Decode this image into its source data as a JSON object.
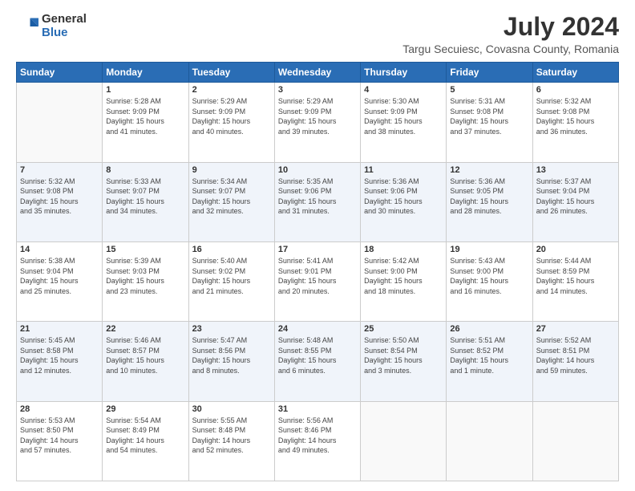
{
  "header": {
    "logo_general": "General",
    "logo_blue": "Blue",
    "title": "July 2024",
    "subtitle": "Targu Secuiesc, Covasna County, Romania"
  },
  "weekdays": [
    "Sunday",
    "Monday",
    "Tuesday",
    "Wednesday",
    "Thursday",
    "Friday",
    "Saturday"
  ],
  "weeks": [
    [
      {
        "day": "",
        "info": ""
      },
      {
        "day": "1",
        "info": "Sunrise: 5:28 AM\nSunset: 9:09 PM\nDaylight: 15 hours\nand 41 minutes."
      },
      {
        "day": "2",
        "info": "Sunrise: 5:29 AM\nSunset: 9:09 PM\nDaylight: 15 hours\nand 40 minutes."
      },
      {
        "day": "3",
        "info": "Sunrise: 5:29 AM\nSunset: 9:09 PM\nDaylight: 15 hours\nand 39 minutes."
      },
      {
        "day": "4",
        "info": "Sunrise: 5:30 AM\nSunset: 9:09 PM\nDaylight: 15 hours\nand 38 minutes."
      },
      {
        "day": "5",
        "info": "Sunrise: 5:31 AM\nSunset: 9:08 PM\nDaylight: 15 hours\nand 37 minutes."
      },
      {
        "day": "6",
        "info": "Sunrise: 5:32 AM\nSunset: 9:08 PM\nDaylight: 15 hours\nand 36 minutes."
      }
    ],
    [
      {
        "day": "7",
        "info": "Sunrise: 5:32 AM\nSunset: 9:08 PM\nDaylight: 15 hours\nand 35 minutes."
      },
      {
        "day": "8",
        "info": "Sunrise: 5:33 AM\nSunset: 9:07 PM\nDaylight: 15 hours\nand 34 minutes."
      },
      {
        "day": "9",
        "info": "Sunrise: 5:34 AM\nSunset: 9:07 PM\nDaylight: 15 hours\nand 32 minutes."
      },
      {
        "day": "10",
        "info": "Sunrise: 5:35 AM\nSunset: 9:06 PM\nDaylight: 15 hours\nand 31 minutes."
      },
      {
        "day": "11",
        "info": "Sunrise: 5:36 AM\nSunset: 9:06 PM\nDaylight: 15 hours\nand 30 minutes."
      },
      {
        "day": "12",
        "info": "Sunrise: 5:36 AM\nSunset: 9:05 PM\nDaylight: 15 hours\nand 28 minutes."
      },
      {
        "day": "13",
        "info": "Sunrise: 5:37 AM\nSunset: 9:04 PM\nDaylight: 15 hours\nand 26 minutes."
      }
    ],
    [
      {
        "day": "14",
        "info": "Sunrise: 5:38 AM\nSunset: 9:04 PM\nDaylight: 15 hours\nand 25 minutes."
      },
      {
        "day": "15",
        "info": "Sunrise: 5:39 AM\nSunset: 9:03 PM\nDaylight: 15 hours\nand 23 minutes."
      },
      {
        "day": "16",
        "info": "Sunrise: 5:40 AM\nSunset: 9:02 PM\nDaylight: 15 hours\nand 21 minutes."
      },
      {
        "day": "17",
        "info": "Sunrise: 5:41 AM\nSunset: 9:01 PM\nDaylight: 15 hours\nand 20 minutes."
      },
      {
        "day": "18",
        "info": "Sunrise: 5:42 AM\nSunset: 9:00 PM\nDaylight: 15 hours\nand 18 minutes."
      },
      {
        "day": "19",
        "info": "Sunrise: 5:43 AM\nSunset: 9:00 PM\nDaylight: 15 hours\nand 16 minutes."
      },
      {
        "day": "20",
        "info": "Sunrise: 5:44 AM\nSunset: 8:59 PM\nDaylight: 15 hours\nand 14 minutes."
      }
    ],
    [
      {
        "day": "21",
        "info": "Sunrise: 5:45 AM\nSunset: 8:58 PM\nDaylight: 15 hours\nand 12 minutes."
      },
      {
        "day": "22",
        "info": "Sunrise: 5:46 AM\nSunset: 8:57 PM\nDaylight: 15 hours\nand 10 minutes."
      },
      {
        "day": "23",
        "info": "Sunrise: 5:47 AM\nSunset: 8:56 PM\nDaylight: 15 hours\nand 8 minutes."
      },
      {
        "day": "24",
        "info": "Sunrise: 5:48 AM\nSunset: 8:55 PM\nDaylight: 15 hours\nand 6 minutes."
      },
      {
        "day": "25",
        "info": "Sunrise: 5:50 AM\nSunset: 8:54 PM\nDaylight: 15 hours\nand 3 minutes."
      },
      {
        "day": "26",
        "info": "Sunrise: 5:51 AM\nSunset: 8:52 PM\nDaylight: 15 hours\nand 1 minute."
      },
      {
        "day": "27",
        "info": "Sunrise: 5:52 AM\nSunset: 8:51 PM\nDaylight: 14 hours\nand 59 minutes."
      }
    ],
    [
      {
        "day": "28",
        "info": "Sunrise: 5:53 AM\nSunset: 8:50 PM\nDaylight: 14 hours\nand 57 minutes."
      },
      {
        "day": "29",
        "info": "Sunrise: 5:54 AM\nSunset: 8:49 PM\nDaylight: 14 hours\nand 54 minutes."
      },
      {
        "day": "30",
        "info": "Sunrise: 5:55 AM\nSunset: 8:48 PM\nDaylight: 14 hours\nand 52 minutes."
      },
      {
        "day": "31",
        "info": "Sunrise: 5:56 AM\nSunset: 8:46 PM\nDaylight: 14 hours\nand 49 minutes."
      },
      {
        "day": "",
        "info": ""
      },
      {
        "day": "",
        "info": ""
      },
      {
        "day": "",
        "info": ""
      }
    ]
  ]
}
